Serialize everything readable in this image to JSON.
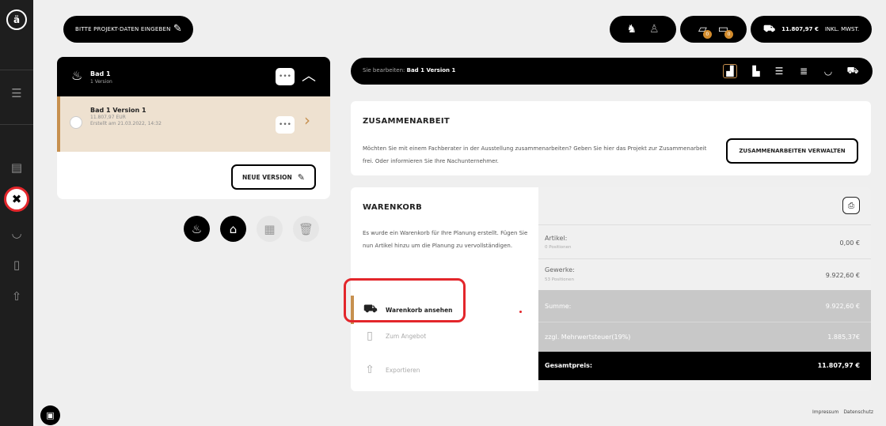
{
  "sidebar": {
    "logo_text": "ä",
    "icons": [
      "menu-icon",
      "document-stack-icon",
      "tools-icon",
      "sofa-icon",
      "file-icon",
      "export-icon"
    ]
  },
  "topbar": {
    "project_label": "BITTE PROJEKT-DATEN EINGEBEN",
    "badge_counts": [
      "0",
      "0"
    ],
    "cart_total": "11.807,97 €",
    "cart_tax_note": "INKL. MWST."
  },
  "project": {
    "name": "Bad 1",
    "versions_count": "1 Version",
    "version": {
      "name": "Bad 1 Version 1",
      "price": "11.807,97 EUR",
      "created": "Erstellt am 21.03.2022, 14:32"
    },
    "more_label": "•••",
    "new_version_label": "NEUE VERSION"
  },
  "edit_bar": {
    "prefix": "Sie bearbeiten:",
    "target": "Bad 1 Version 1"
  },
  "collaboration": {
    "title": "ZUSAMMENARBEIT",
    "text": "Möchten Sie mit einem Fachberater in der Ausstellung zusammenarbeiten? Geben Sie hier das Projekt zur Zusammenarbeit frei. Oder informieren Sie Ihre Nachunternehmer.",
    "button_label": "ZUSAMMENARBEITEN VERWALTEN"
  },
  "cart": {
    "title": "WARENKORB",
    "text": "Es wurde ein Warenkorb für Ihre Planung erstellt. Fügen Sie nun Artikel hinzu um die Planung zu vervollständigen.",
    "actions": {
      "view": "Warenkorb ansehen",
      "offer": "Zum Angebot",
      "export": "Exportieren"
    },
    "summary": {
      "articles_label": "Artikel:",
      "articles_sub": "0 Positionen",
      "articles_value": "0,00 €",
      "trades_label": "Gewerke:",
      "trades_sub": "53 Positionen",
      "trades_value": "9.922,60 €",
      "sum_label": "Summe:",
      "sum_value": "9.922,60 €",
      "vat_label": "zzgl. Mehrwertsteuer(19%)",
      "vat_value": "1.885,37€",
      "total_label": "Gesamtpreis:",
      "total_value": "11.807,97 €"
    }
  },
  "footer": {
    "imprint": "Impressum",
    "privacy": "Datenschutz"
  },
  "colors": {
    "accent": "#c7904f",
    "highlight": "#e3262b",
    "version_bg": "#eee1d0"
  }
}
